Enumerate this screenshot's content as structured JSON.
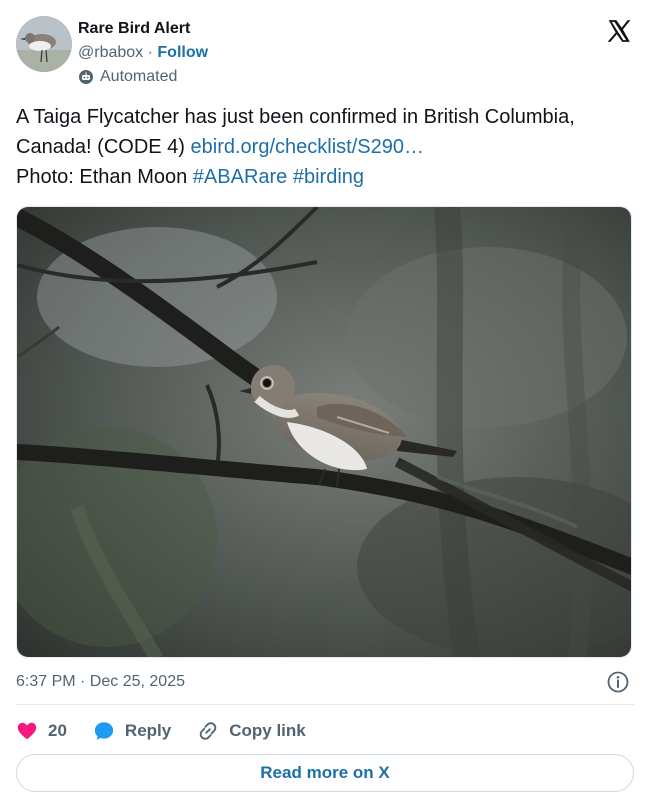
{
  "header": {
    "name": "Rare Bird Alert",
    "handle": "@rbabox",
    "separator": " · ",
    "follow_label": "Follow",
    "automated_label": "Automated"
  },
  "post": {
    "text_before_link": "A Taiga Flycatcher has just been confirmed in British Columbia, Canada! (CODE 4) ",
    "link_text": "ebird.org/checklist/S290…",
    "photo_credit": "Photo: Ethan Moon ",
    "hashtag1": "#ABARare",
    "hashtag2": "#birding"
  },
  "meta": {
    "timestamp": "6:37 PM · Dec 25, 2025"
  },
  "actions": {
    "like_count": "20",
    "reply_label": "Reply",
    "copy_label": "Copy link"
  },
  "footer": {
    "read_more_label": "Read more on X"
  },
  "colors": {
    "link": "#1d6fa8",
    "heart": "#f91880",
    "reply_bubble": "#1d9bf0",
    "muted": "#536471"
  },
  "icons": [
    "x-logo-icon",
    "bot-icon",
    "info-icon",
    "heart-icon",
    "reply-bubble-icon",
    "link-icon"
  ]
}
